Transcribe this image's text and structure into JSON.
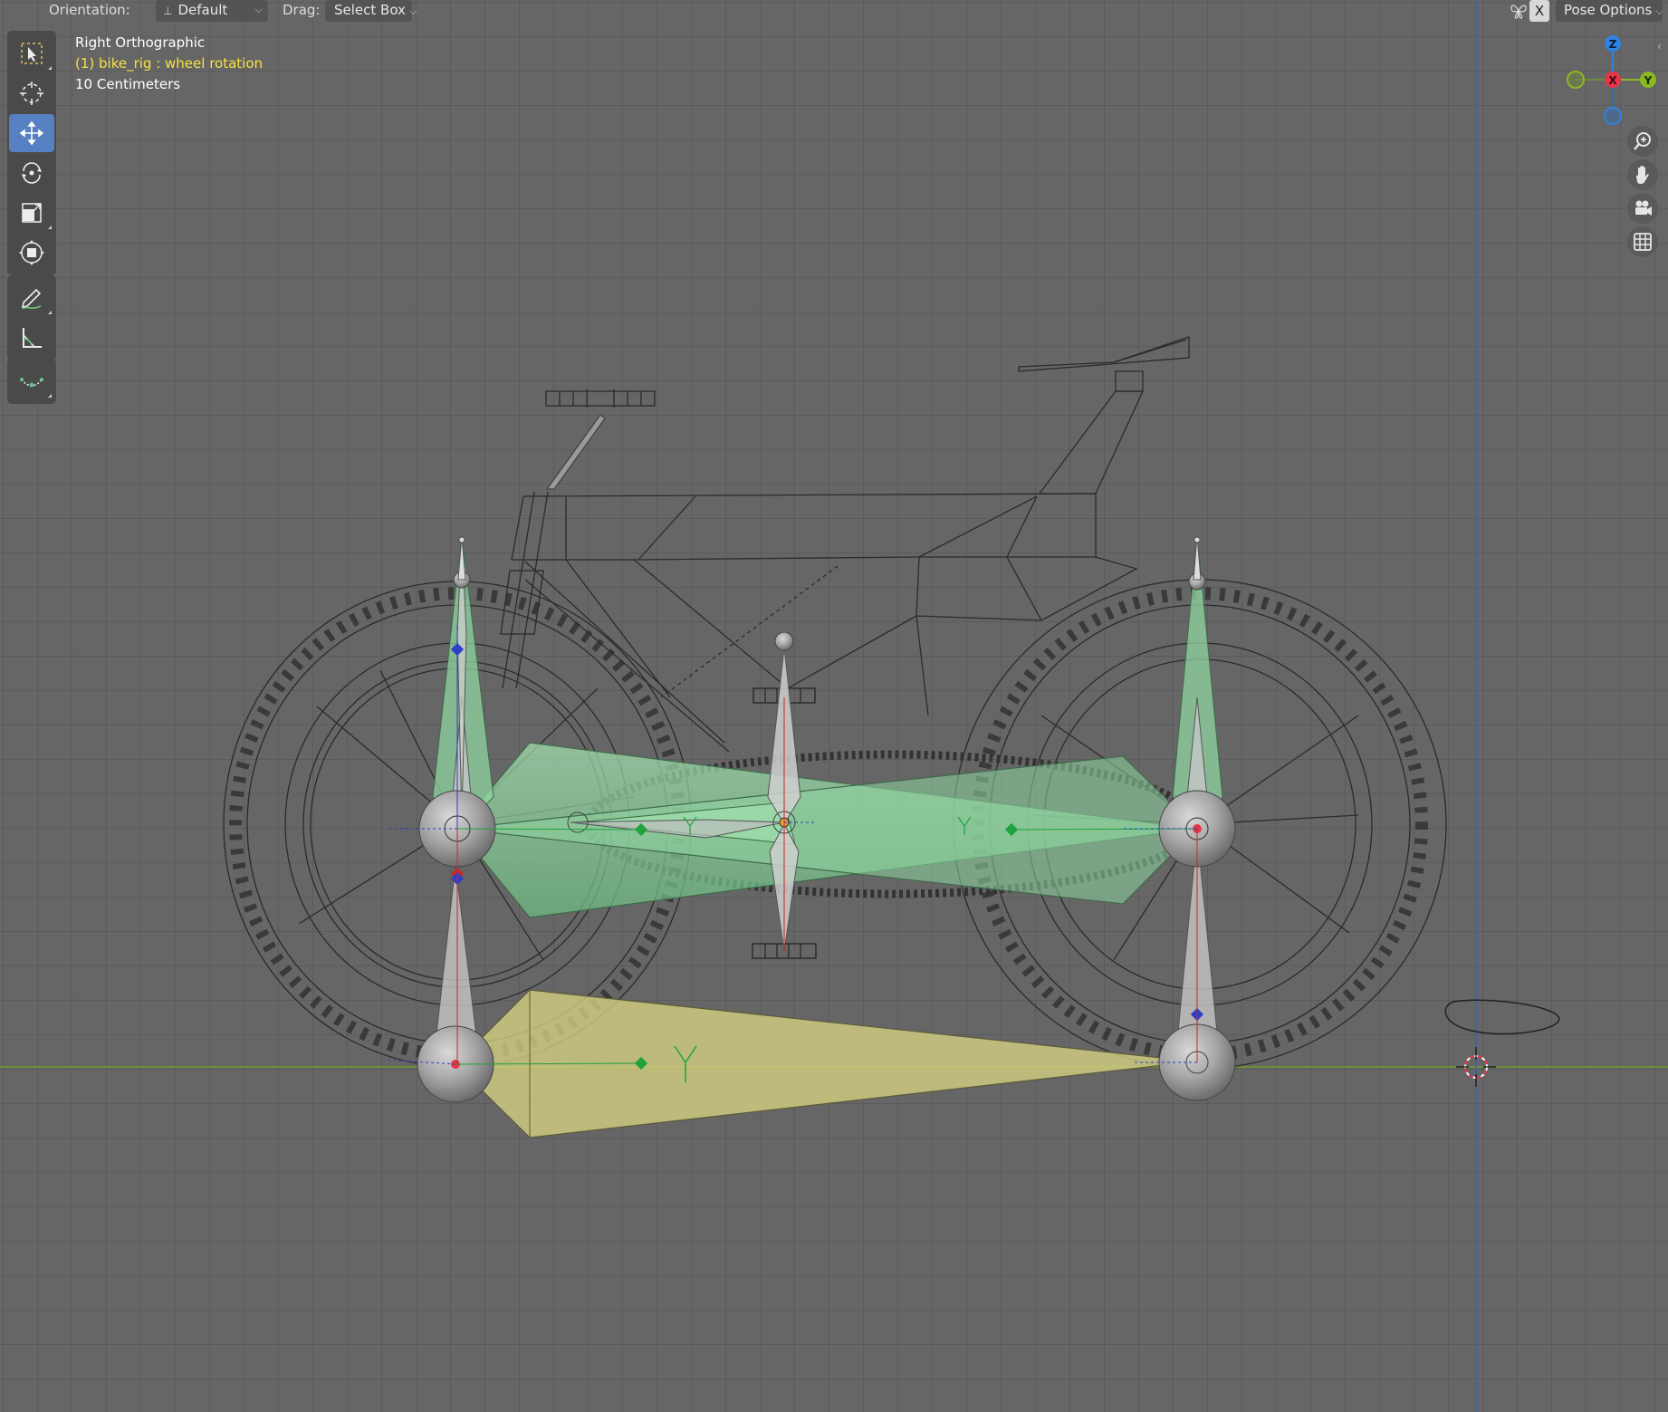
{
  "header": {
    "orientation_label": "Orientation:",
    "orientation_value": "Default",
    "drag_label": "Drag:",
    "drag_value": "Select Box",
    "x_toggle": "X",
    "pose_options": "Pose Options"
  },
  "overlay": {
    "view_name": "Right Orthographic",
    "object_info": "(1) bike_rig : wheel rotation",
    "grid_scale": "10 Centimeters"
  },
  "gizmo": {
    "z_label": "Z",
    "x_label": "X",
    "y_label": "Y"
  },
  "toolbar": {
    "tools": [
      "select-box",
      "cursor",
      "move",
      "rotate",
      "scale",
      "transform",
      "annotate",
      "measure",
      "extrude-curve"
    ],
    "active_tool": "move"
  },
  "nav_buttons": [
    "zoom-icon",
    "hand-icon",
    "camera-icon",
    "grid-icon"
  ],
  "colors": {
    "viewport_bg": "#666666",
    "active_tool": "#5680c2",
    "axis_x": "#e8344a",
    "axis_y": "#8ab922",
    "axis_z": "#2f83e3",
    "selected_bone": "#8fd6a0",
    "active_bone": "#e8e08a",
    "object_info_text": "#f6e141"
  }
}
